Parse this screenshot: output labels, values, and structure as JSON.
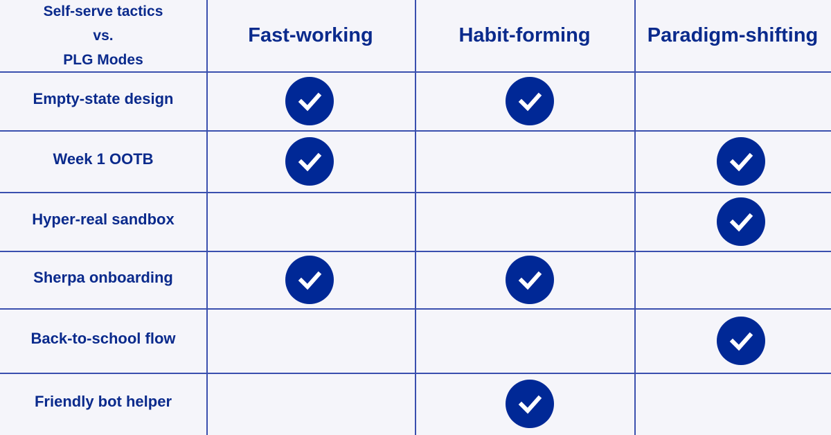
{
  "corner_label": [
    "Self-serve tactics",
    "vs.",
    "PLG Modes"
  ],
  "columns": [
    "Fast-working",
    "Habit-forming",
    "Paradigm-shifting"
  ],
  "rows": [
    {
      "label": "Empty-state design",
      "checks": [
        true,
        true,
        false
      ]
    },
    {
      "label": "Week 1 OOTB",
      "checks": [
        true,
        false,
        true
      ]
    },
    {
      "label": "Hyper-real sandbox",
      "checks": [
        false,
        false,
        true
      ]
    },
    {
      "label": "Sherpa onboarding",
      "checks": [
        true,
        true,
        false
      ]
    },
    {
      "label": "Back-to-school flow",
      "checks": [
        false,
        false,
        true
      ]
    },
    {
      "label": "Friendly bot helper",
      "checks": [
        false,
        true,
        false
      ]
    }
  ],
  "colors": {
    "background": "#f5f5fa",
    "text": "#0a2a8c",
    "check_fill": "#002896",
    "grid_line": "#3a4fae"
  },
  "icon": "check-circle-icon"
}
